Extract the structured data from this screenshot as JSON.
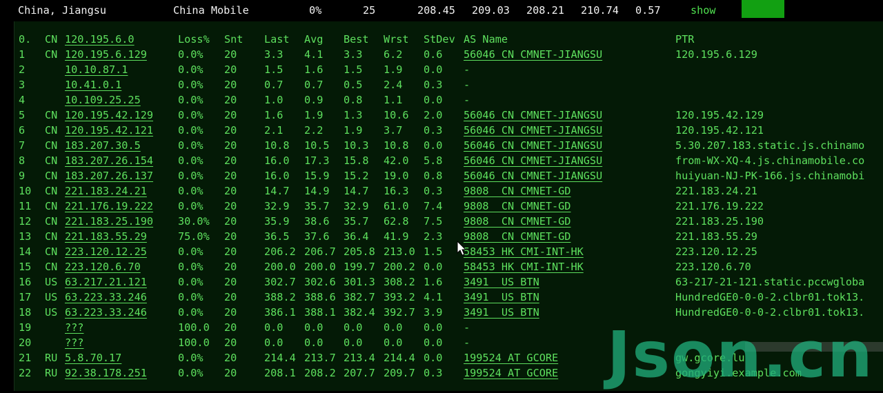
{
  "summary": {
    "location": "China, Jiangsu",
    "isp": "China Mobile",
    "loss": "0%",
    "sent": "25",
    "last": "208.45",
    "avg": "209.03",
    "best": "208.21",
    "worst": "210.74",
    "stdev": "0.57",
    "toggle_label": "show",
    "mini_chart_levels": [
      1.0,
      0.85
    ]
  },
  "columns": {
    "hop": "0.",
    "host": "120.195.6.0",
    "loss": "Loss%",
    "snt": "Snt",
    "last": "Last",
    "avg": "Avg",
    "best": "Best",
    "wrst": "Wrst",
    "stdev": "StDev",
    "as_name": "AS Name",
    "ptr": "PTR",
    "country": "CN"
  },
  "hops": [
    {
      "hop": "1",
      "cc": "CN",
      "host": "120.195.6.129",
      "loss": "0.0%",
      "snt": "20",
      "last": "3.3",
      "avg": "4.1",
      "best": "3.3",
      "wrst": "6.2",
      "stdev": "0.6",
      "as": "56046 CN CMNET-JIANGSU",
      "ptr": "120.195.6.129"
    },
    {
      "hop": "2",
      "cc": "",
      "host": "10.10.87.1",
      "loss": "0.0%",
      "snt": "20",
      "last": "1.5",
      "avg": "1.6",
      "best": "1.5",
      "wrst": "1.9",
      "stdev": "0.0",
      "as": "-",
      "ptr": ""
    },
    {
      "hop": "3",
      "cc": "",
      "host": "10.41.0.1",
      "loss": "0.0%",
      "snt": "20",
      "last": "0.7",
      "avg": "0.7",
      "best": "0.5",
      "wrst": "2.4",
      "stdev": "0.3",
      "as": "-",
      "ptr": ""
    },
    {
      "hop": "4",
      "cc": "",
      "host": "10.109.25.25",
      "loss": "0.0%",
      "snt": "20",
      "last": "1.0",
      "avg": "0.9",
      "best": "0.8",
      "wrst": "1.1",
      "stdev": "0.0",
      "as": "-",
      "ptr": ""
    },
    {
      "hop": "5",
      "cc": "CN",
      "host": "120.195.42.129",
      "loss": "0.0%",
      "snt": "20",
      "last": "1.6",
      "avg": "1.9",
      "best": "1.3",
      "wrst": "10.6",
      "stdev": "2.0",
      "as": "56046 CN CMNET-JIANGSU",
      "ptr": "120.195.42.129"
    },
    {
      "hop": "6",
      "cc": "CN",
      "host": "120.195.42.121",
      "loss": "0.0%",
      "snt": "20",
      "last": "2.1",
      "avg": "2.2",
      "best": "1.9",
      "wrst": "3.7",
      "stdev": "0.3",
      "as": "56046 CN CMNET-JIANGSU",
      "ptr": "120.195.42.121"
    },
    {
      "hop": "7",
      "cc": "CN",
      "host": "183.207.30.5",
      "loss": "0.0%",
      "snt": "20",
      "last": "10.8",
      "avg": "10.5",
      "best": "10.3",
      "wrst": "10.8",
      "stdev": "0.0",
      "as": "56046 CN CMNET-JIANGSU",
      "ptr": "5.30.207.183.static.js.chinamo"
    },
    {
      "hop": "8",
      "cc": "CN",
      "host": "183.207.26.154",
      "loss": "0.0%",
      "snt": "20",
      "last": "16.0",
      "avg": "17.3",
      "best": "15.8",
      "wrst": "42.0",
      "stdev": "5.8",
      "as": "56046 CN CMNET-JIANGSU",
      "ptr": "from-WX-XQ-4.js.chinamobile.co"
    },
    {
      "hop": "9",
      "cc": "CN",
      "host": "183.207.26.137",
      "loss": "0.0%",
      "snt": "20",
      "last": "16.0",
      "avg": "15.9",
      "best": "15.2",
      "wrst": "19.0",
      "stdev": "0.8",
      "as": "56046 CN CMNET-JIANGSU",
      "ptr": "huiyuan-NJ-PK-166.js.chinamobi"
    },
    {
      "hop": "10",
      "cc": "CN",
      "host": "221.183.24.21",
      "loss": "0.0%",
      "snt": "20",
      "last": "14.7",
      "avg": "14.9",
      "best": "14.7",
      "wrst": "16.3",
      "stdev": "0.3",
      "as": "9808  CN CMNET-GD",
      "ptr": "221.183.24.21"
    },
    {
      "hop": "11",
      "cc": "CN",
      "host": "221.176.19.222",
      "loss": "0.0%",
      "snt": "20",
      "last": "32.9",
      "avg": "35.7",
      "best": "32.9",
      "wrst": "61.0",
      "stdev": "7.4",
      "as": "9808  CN CMNET-GD",
      "ptr": "221.176.19.222"
    },
    {
      "hop": "12",
      "cc": "CN",
      "host": "221.183.25.190",
      "loss": "30.0%",
      "snt": "20",
      "last": "35.9",
      "avg": "38.6",
      "best": "35.7",
      "wrst": "62.8",
      "stdev": "7.5",
      "as": "9808  CN CMNET-GD",
      "ptr": "221.183.25.190"
    },
    {
      "hop": "13",
      "cc": "CN",
      "host": "221.183.55.29",
      "loss": "75.0%",
      "snt": "20",
      "last": "36.5",
      "avg": "37.6",
      "best": "36.4",
      "wrst": "41.9",
      "stdev": "2.3",
      "as": "9808  CN CMNET-GD",
      "ptr": "221.183.55.29"
    },
    {
      "hop": "14",
      "cc": "CN",
      "host": "223.120.12.25",
      "loss": "0.0%",
      "snt": "20",
      "last": "206.2",
      "avg": "206.7",
      "best": "205.8",
      "wrst": "213.0",
      "stdev": "1.5",
      "as": "58453 HK CMI-INT-HK",
      "ptr": "223.120.12.25"
    },
    {
      "hop": "15",
      "cc": "CN",
      "host": "223.120.6.70",
      "loss": "0.0%",
      "snt": "20",
      "last": "200.0",
      "avg": "200.0",
      "best": "199.7",
      "wrst": "200.2",
      "stdev": "0.0",
      "as": "58453 HK CMI-INT-HK",
      "ptr": "223.120.6.70"
    },
    {
      "hop": "16",
      "cc": "US",
      "host": "63.217.21.121",
      "loss": "0.0%",
      "snt": "20",
      "last": "302.7",
      "avg": "302.6",
      "best": "301.3",
      "wrst": "308.2",
      "stdev": "1.6",
      "as": "3491  US BTN",
      "ptr": "63-217-21-121.static.pccwgloba"
    },
    {
      "hop": "17",
      "cc": "US",
      "host": "63.223.33.246",
      "loss": "0.0%",
      "snt": "20",
      "last": "388.2",
      "avg": "388.6",
      "best": "382.7",
      "wrst": "393.2",
      "stdev": "4.1",
      "as": "3491  US BTN",
      "ptr": "HundredGE0-0-0-2.clbr01.tok13."
    },
    {
      "hop": "18",
      "cc": "US",
      "host": "63.223.33.246",
      "loss": "0.0%",
      "snt": "20",
      "last": "386.1",
      "avg": "388.1",
      "best": "382.4",
      "wrst": "392.7",
      "stdev": "3.9",
      "as": "3491  US BTN",
      "ptr": "HundredGE0-0-0-2.clbr01.tok13."
    },
    {
      "hop": "19",
      "cc": "",
      "host": "???",
      "loss": "100.0",
      "snt": "20",
      "last": "0.0",
      "avg": "0.0",
      "best": "0.0",
      "wrst": "0.0",
      "stdev": "0.0",
      "as": "-",
      "ptr": ""
    },
    {
      "hop": "20",
      "cc": "",
      "host": "???",
      "loss": "100.0",
      "snt": "20",
      "last": "0.0",
      "avg": "0.0",
      "best": "0.0",
      "wrst": "0.0",
      "stdev": "0.0",
      "as": "-",
      "ptr": ""
    },
    {
      "hop": "21",
      "cc": "RU",
      "host": "5.8.70.17",
      "loss": "0.0%",
      "snt": "20",
      "last": "214.4",
      "avg": "213.7",
      "best": "213.4",
      "wrst": "214.4",
      "stdev": "0.0",
      "as": "199524 AT GCORE",
      "ptr": "gw.gcore.lu"
    },
    {
      "hop": "22",
      "cc": "RU",
      "host": "92.38.178.251",
      "loss": "0.0%",
      "snt": "20",
      "last": "208.1",
      "avg": "208.2",
      "best": "207.7",
      "wrst": "209.7",
      "stdev": "0.3",
      "as": "199524 AT GCORE",
      "ptr": "gongyiyi.example.com"
    }
  ],
  "watermark": {
    "text": "Json.cn"
  },
  "colors": {
    "text_green": "#5ee05e",
    "panel_bg": "#041a06",
    "header_text": "#f2f2f2",
    "bar_green": "#12a012"
  },
  "icons": {
    "cursor": "mouse-pointer-icon"
  }
}
